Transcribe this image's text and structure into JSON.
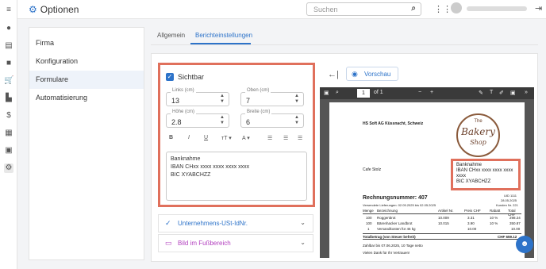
{
  "app": {
    "title": "Optionen"
  },
  "search": {
    "placeholder": "Suchen"
  },
  "sidebar": {
    "items": [
      {
        "label": "Firma",
        "active": false
      },
      {
        "label": "Konfiguration",
        "active": false
      },
      {
        "label": "Formulare",
        "active": true
      },
      {
        "label": "Automatisierung",
        "active": false
      }
    ]
  },
  "tabs": [
    {
      "label": "Allgemein"
    },
    {
      "label": "Berichteinstellungen",
      "active": true
    }
  ],
  "panel": {
    "visible_label": "Sichtbar",
    "left": {
      "label": "Links (cm)",
      "value": "13"
    },
    "top": {
      "label": "Oben (cm)",
      "value": "7"
    },
    "height": {
      "label": "Höhe (cm)",
      "value": "2.8"
    },
    "width": {
      "label": "Breite (cm)",
      "value": "6"
    },
    "toolbar": {
      "bold": "B",
      "italic": "I",
      "underline": "U",
      "size": "тT ▾",
      "color": "A ▾"
    },
    "text": {
      "line1": "Banknahme",
      "line2": "IBAN CHxx xxxx xxxx xxxx xxxx",
      "line3": "BIC XYABCHZZ"
    }
  },
  "accordion": [
    {
      "label": "Unternehmens-USt-IdNr.",
      "color": "#2d73c9"
    },
    {
      "label": "Bild im Fußbereich",
      "color": "#b23fbf"
    }
  ],
  "preview": {
    "button": "Vorschau"
  },
  "pdf": {
    "page": "1",
    "of": "of 1",
    "sender": "HS Soft AG Küssnacht, Schweiz",
    "recipient": "Cafe Stolz",
    "logo_the": "The",
    "logo_bakery": "Bakery",
    "logo_shop": "Shop",
    "bank": {
      "line1": "Banknahme",
      "line2": "IBAN CHxx xxxx xxxx xxxx",
      "line3": "xxxx",
      "line4": "BIC XYABCHZZ"
    },
    "invoice_title": "Rechnungsnummer: 407",
    "invoice_sub": "Versendete Lieferungen: 02.05.2025 bis 02.05.2025",
    "uid": "UID 1111",
    "date": "28.05.2025",
    "customer": "Kunden Nr. 221",
    "headers": [
      "Menge",
      "Bezeichnung",
      "Artikel Nr.",
      "Preis CHF",
      "Rabatt",
      "Total CHF"
    ],
    "rows": [
      [
        "100",
        "Roggenbrot",
        "10.009",
        "3.31",
        "10 %",
        "298.24"
      ],
      [
        "100",
        "Bärenhacker Landbrot",
        "10.015",
        "3.90",
        "10 %",
        "350.87"
      ],
      [
        "1",
        "Versandkosten für 45 kg",
        "",
        "10.00",
        "",
        "10.00"
      ]
    ],
    "total_label": "Totalbetrag (von Steuer befreit)",
    "total_value": "CHF 659.12",
    "payable": "Zahlbar bis 07.06.2025, 10 Tage netto",
    "thanks": "Vielen Dank für Ihr Vertrauen!"
  }
}
